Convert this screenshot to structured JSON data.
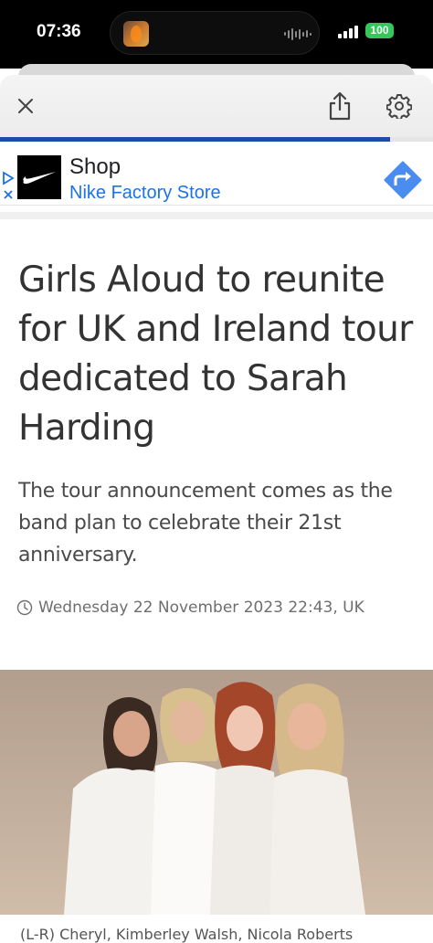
{
  "status_bar": {
    "time": "07:36",
    "battery": "100"
  },
  "toolbar": {
    "close_icon": "close-icon",
    "share_icon": "share-icon",
    "settings_icon": "gear-icon",
    "progress_fraction": 0.9
  },
  "ad": {
    "title": "Shop",
    "subtitle": "Nike Factory Store",
    "go_icon": "directions-arrow-icon"
  },
  "article": {
    "headline": "Girls Aloud to reunite for UK and Ireland tour dedicated to Sarah Harding",
    "standfirst": "The tour announcement comes as the band plan to celebrate their 21st anniversary.",
    "date": "Wednesday 22 November 2023 22:43, UK",
    "caption": "(L-R) Cheryl, Kimberley Walsh, Nicola Roberts"
  },
  "colors": {
    "progress": "#1d4ea5",
    "ad_link": "#1a73e8",
    "battery": "#34c759"
  }
}
